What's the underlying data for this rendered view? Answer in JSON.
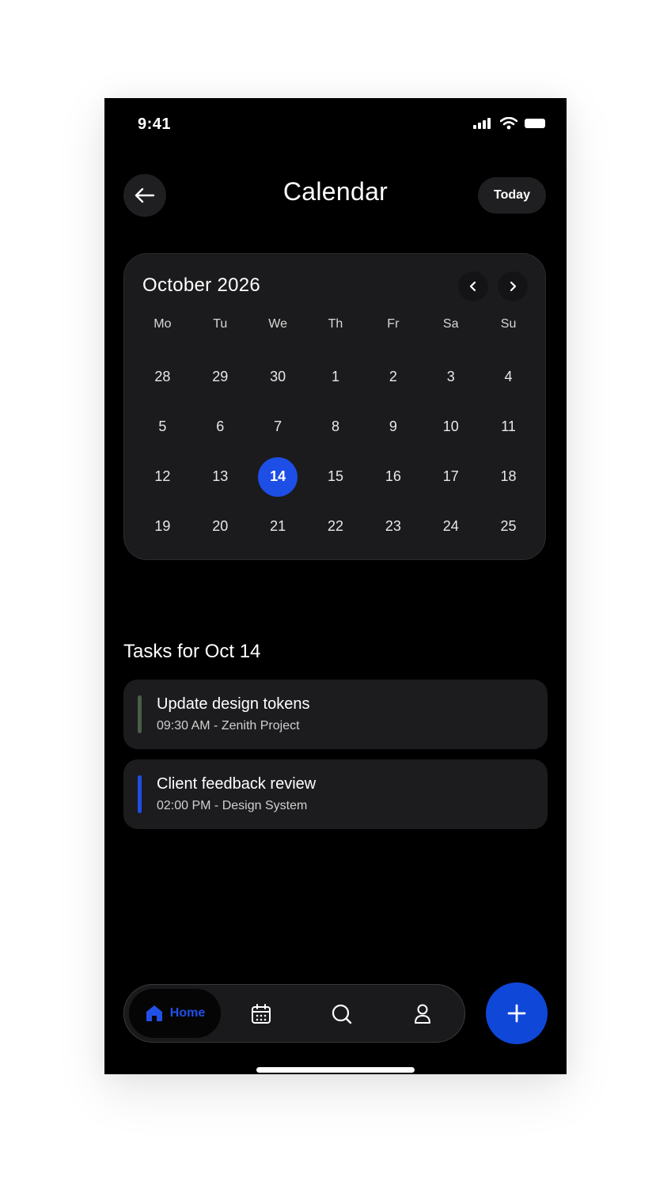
{
  "status_bar": {
    "time": "9:41"
  },
  "header": {
    "title": "Calendar",
    "today_label": "Today"
  },
  "calendar": {
    "month_label": "October 2026",
    "weekdays": [
      "Mo",
      "Tu",
      "We",
      "Th",
      "Fr",
      "Sa",
      "Su"
    ],
    "days": [
      "28",
      "29",
      "30",
      "1",
      "2",
      "3",
      "4",
      "5",
      "6",
      "7",
      "8",
      "9",
      "10",
      "11",
      "12",
      "13",
      "14",
      "15",
      "16",
      "17",
      "18",
      "19",
      "20",
      "21",
      "22",
      "23",
      "24",
      "25"
    ],
    "selected_day": "14"
  },
  "tasks": {
    "heading": "Tasks for Oct 14",
    "items": [
      {
        "title": "Update design tokens",
        "subtitle": "09:30 AM - Zenith Project",
        "accent": "#4a5e46"
      },
      {
        "title": "Client feedback review",
        "subtitle": "02:00 PM - Design System",
        "accent": "#1d4ee6"
      }
    ]
  },
  "tab_bar": {
    "home_label": "Home",
    "active_tab": "home"
  },
  "colors": {
    "accent": "#1d4ee6",
    "fab": "#0f47d8",
    "background": "#000000",
    "card": "#1b1b1d"
  },
  "icons": [
    "back-arrow-icon",
    "chevron-left-icon",
    "chevron-right-icon",
    "home-icon",
    "calendar-icon",
    "search-icon",
    "user-icon",
    "plus-icon",
    "signal-icon",
    "wifi-icon",
    "battery-icon"
  ]
}
